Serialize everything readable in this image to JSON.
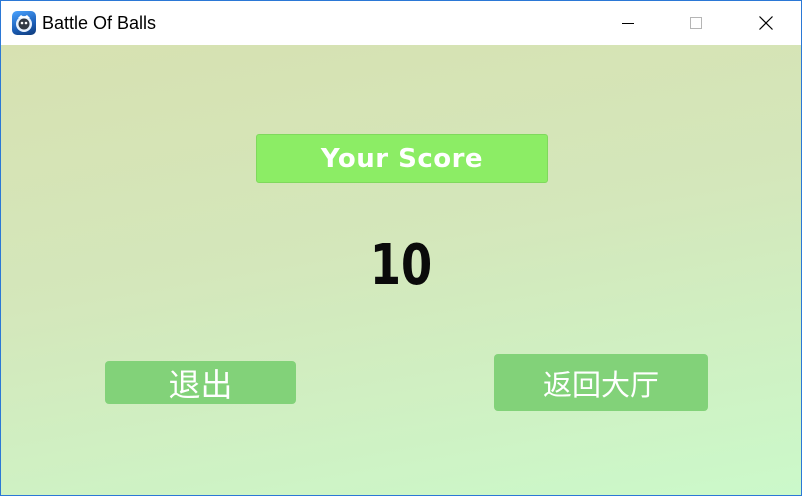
{
  "window": {
    "title": "Battle Of Balls",
    "app_icon": "battle-of-balls-app-icon"
  },
  "controls": {
    "minimize_icon": "minimize-icon",
    "maximize_icon": "maximize-icon",
    "close_icon": "close-icon"
  },
  "main": {
    "score_label": "Your Score",
    "score_value": "10",
    "exit_button": "退出",
    "lobby_button": "返回大厅"
  },
  "colors": {
    "score_label_bg": "#8ced65",
    "button_bg": "#82d279",
    "text_on_button": "#ffffff",
    "score_text": "#0a0a0a"
  }
}
